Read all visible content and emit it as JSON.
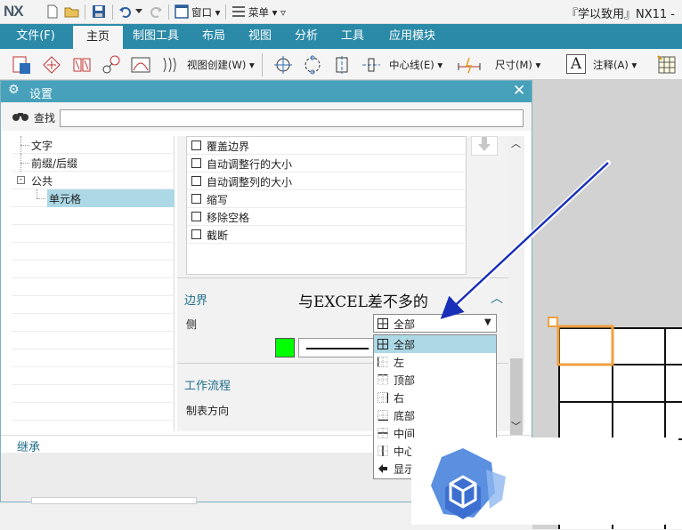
{
  "titlebar": {
    "logo": "NX",
    "window_menu": "窗口",
    "menu": "菜单",
    "app_title": "『学以致用』NX11 -"
  },
  "tabs": [
    "文件(F)",
    "主页",
    "制图工具",
    "布局",
    "视图",
    "分析",
    "工具",
    "应用模块"
  ],
  "toolbar": {
    "view_create": "视图创建(W)",
    "centerline": "中心线(E)",
    "dimension": "尺寸(M)",
    "annotation": "注释(A)"
  },
  "dialog": {
    "title": "设置",
    "find_label": "查找",
    "search_value": "",
    "tree": [
      {
        "label": "文字",
        "level": 1
      },
      {
        "label": "前缀/后缀",
        "level": 1
      },
      {
        "label": "公共",
        "level": 0
      },
      {
        "label": "单元格",
        "level": 2
      }
    ],
    "checkboxes": [
      "覆盖边界",
      "自动调整行的大小",
      "自动调整列的大小",
      "缩写",
      "移除空格",
      "截断"
    ],
    "border_section": "边界",
    "side_label": "侧",
    "side_value": "全部",
    "workflow_section": "工作流程",
    "table_direction_label": "制表方向",
    "inherit_label": "继承"
  },
  "dropdown_options": [
    "全部",
    "左",
    "顶部",
    "右",
    "底部",
    "中间",
    "中心",
    "显示"
  ],
  "annotation_text": "与EXCEL差不多的",
  "colors": {
    "tab_bar": "#2b8aa8",
    "dialog_title": "#47a1ba",
    "border_color_swatch": "#00ff00",
    "highlight": "#add8e6",
    "cell_highlight": "#f0a040",
    "arrow": "#1a2fb8"
  }
}
